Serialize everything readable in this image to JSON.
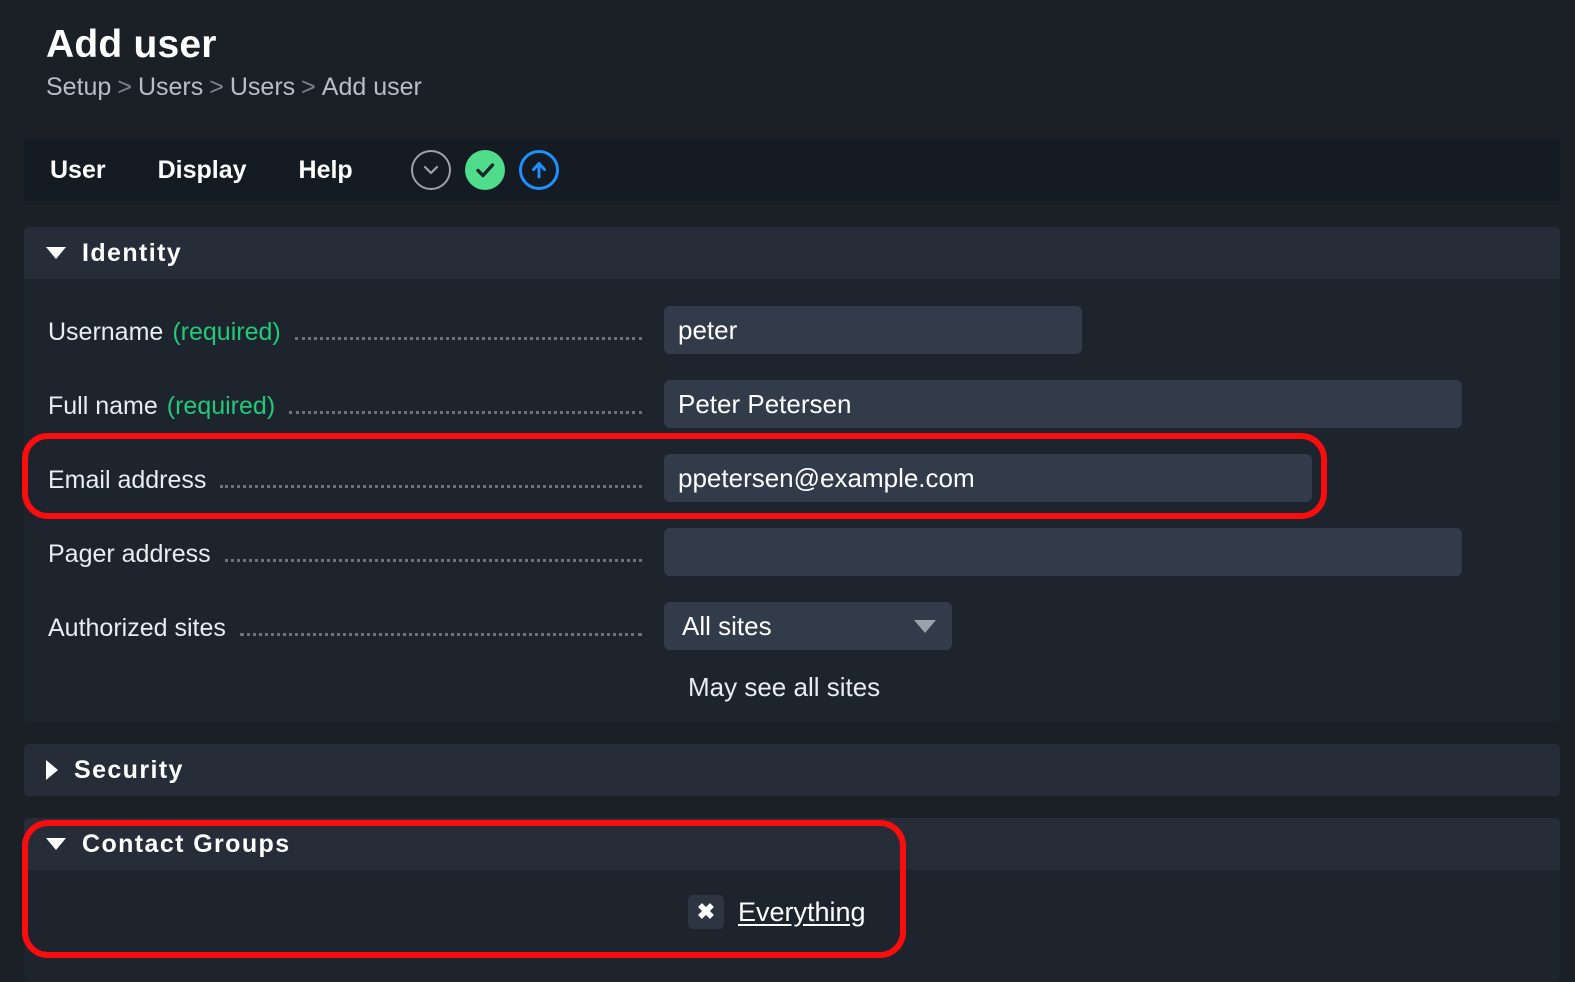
{
  "header": {
    "title": "Add user",
    "breadcrumb": {
      "items": [
        "Setup",
        "Users",
        "Users",
        "Add user"
      ],
      "separator": ">"
    }
  },
  "menubar": {
    "items": [
      {
        "label": "User"
      },
      {
        "label": "Display"
      },
      {
        "label": "Help"
      }
    ],
    "icons": [
      {
        "name": "chevron-down-circle-icon",
        "glyph": "chevron-down",
        "color": "#9aa2ab"
      },
      {
        "name": "save-check-icon",
        "glyph": "check",
        "color": "#4fdc8b"
      },
      {
        "name": "upload-arrow-icon",
        "glyph": "arrow-up",
        "color": "#1f8fff"
      }
    ]
  },
  "sections": {
    "identity": {
      "title": "Identity",
      "expanded": true,
      "toggle_glyph": "▼",
      "rows": [
        {
          "label": "Username",
          "required_text": "(required)",
          "value": "peter",
          "placeholder": ""
        },
        {
          "label": "Full name",
          "required_text": "(required)",
          "value": "Peter Petersen",
          "placeholder": ""
        },
        {
          "label": "Email address",
          "required_text": "",
          "value": "ppetersen@example.com",
          "placeholder": ""
        },
        {
          "label": "Pager address",
          "required_text": "",
          "value": "",
          "placeholder": ""
        }
      ],
      "authorized_sites": {
        "label": "Authorized sites",
        "selected": "All sites",
        "helper": "May see all sites"
      }
    },
    "security": {
      "title": "Security",
      "expanded": false,
      "toggle_glyph": "▶"
    },
    "contact_groups": {
      "title": "Contact Groups",
      "expanded": true,
      "toggle_glyph": "▼",
      "entries": [
        {
          "remove_glyph": "✖",
          "label": "Everything"
        }
      ]
    }
  },
  "annotations": {
    "highlight_color": "#fb0d0d",
    "boxes": [
      {
        "name": "email-address-highlight",
        "target": "Email address"
      },
      {
        "name": "contact-groups-highlight",
        "target": "Contact Groups"
      }
    ]
  }
}
